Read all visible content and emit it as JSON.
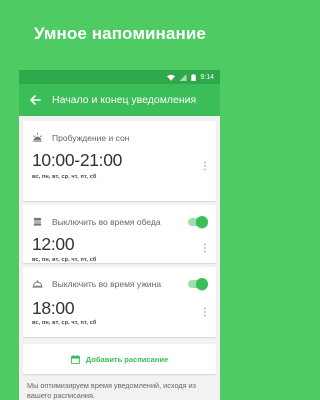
{
  "promo": {
    "title": "Умное напоминание"
  },
  "status_bar": {
    "time": "9:14"
  },
  "toolbar": {
    "title": "Начало и конец уведомления"
  },
  "cards": [
    {
      "label": "Пробуждение и сон",
      "time": "10:00-21:00",
      "days": "вс, пн, вт, ср, чт, пт, сб",
      "icon": "sunrise-icon",
      "toggle": null
    },
    {
      "label": "Выключить во время обеда",
      "time": "12:00",
      "days": "вс, пн, вт, ср, чт, пт, сб",
      "icon": "lunch-icon",
      "toggle": "on"
    },
    {
      "label": "Выключить во время ужина",
      "time": "18:00",
      "days": "вс, пн, вт, ср, чт, пт, сб",
      "icon": "dinner-icon",
      "toggle": "on"
    }
  ],
  "add_button": {
    "label": "Добавить расписание"
  },
  "footnote": "Мы оптимизируем время уведомлений, исходя из вашего расписания.",
  "colors": {
    "background": "#4ecb63",
    "toolbar": "#3bbd57",
    "status_bar": "#2fa84c",
    "accent": "#3bbd57"
  }
}
